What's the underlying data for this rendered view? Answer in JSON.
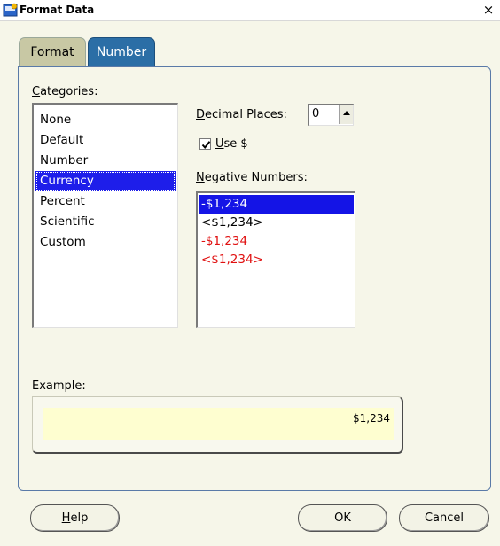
{
  "window": {
    "title": "Format Data",
    "close_glyph": "×"
  },
  "tabs": [
    {
      "label": "Format",
      "active": false
    },
    {
      "label": "Number",
      "active": true
    }
  ],
  "categories": {
    "label_underlined": "C",
    "label_rest": "ategories:",
    "items": [
      "None",
      "Default",
      "Number",
      "Currency",
      "Percent",
      "Scientific",
      "Custom"
    ],
    "selected": "Currency"
  },
  "decimal_places": {
    "label_underlined": "D",
    "label_rest": "ecimal Places:",
    "value": "0"
  },
  "use_dollar": {
    "label_underlined": "U",
    "label_rest": "se $",
    "checked": true
  },
  "negative_numbers": {
    "label_underlined": "N",
    "label_rest": "egative Numbers:",
    "items": [
      {
        "text": "-$1,234",
        "color": "#000000",
        "selected": true
      },
      {
        "text": "<$1,234>",
        "color": "#000000",
        "selected": false
      },
      {
        "text": "-$1,234",
        "color": "#e01010",
        "selected": false
      },
      {
        "text": "<$1,234>",
        "color": "#e01010",
        "selected": false
      }
    ]
  },
  "example": {
    "label": "Example:",
    "value": "$1,234"
  },
  "buttons": {
    "help_underlined": "H",
    "help_rest": "elp",
    "ok": "OK",
    "cancel": "Cancel"
  },
  "colors": {
    "accent_tab": "#2b6ea6",
    "selection": "#1e1eea",
    "negative_red": "#e01010",
    "example_bg": "#fefed0"
  }
}
